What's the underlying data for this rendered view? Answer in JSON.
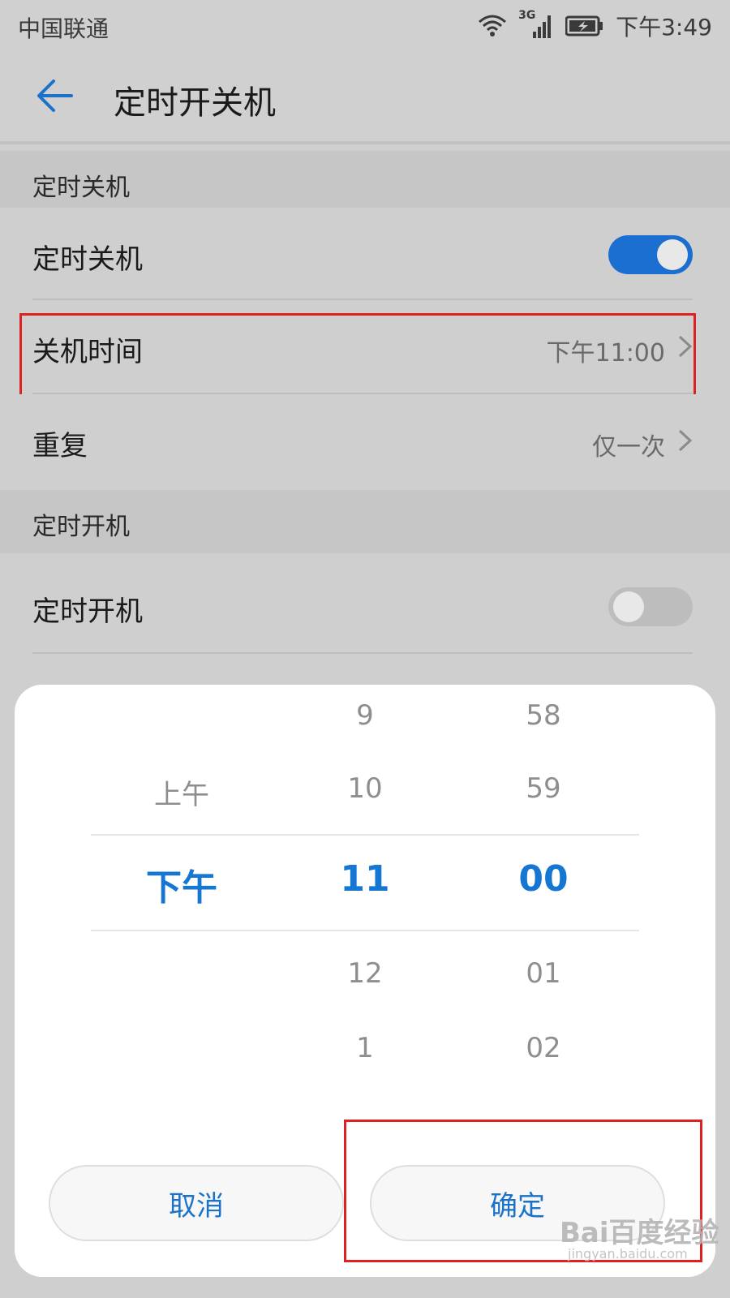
{
  "status_bar": {
    "carrier": "中国联通",
    "network": "3G",
    "time": "下午3:49"
  },
  "app_bar": {
    "title": "定时开关机"
  },
  "sections": {
    "shutdown": {
      "header": "定时关机",
      "toggle_label": "定时关机",
      "toggle_on": true,
      "time_label": "关机时间",
      "time_value": "下午11:00",
      "repeat_label": "重复",
      "repeat_value": "仅一次"
    },
    "startup": {
      "header": "定时开机",
      "toggle_label": "定时开机",
      "toggle_on": false
    }
  },
  "time_picker": {
    "ampm": {
      "above": "上午",
      "selected": "下午"
    },
    "hours": {
      "above2": "9",
      "above1": "10",
      "selected": "11",
      "below1": "12",
      "below2": "1"
    },
    "minutes": {
      "above2": "58",
      "above1": "59",
      "selected": "00",
      "below1": "01",
      "below2": "02"
    },
    "cancel_label": "取消",
    "confirm_label": "确定"
  },
  "watermark": {
    "text": "Bai百度经验",
    "sub": "jingyan.baidu.com"
  },
  "colors": {
    "accent": "#1677d2",
    "toggle_on": "#1a6fd1",
    "toggle_off": "#bdbdbd",
    "highlight": "#e02020"
  }
}
